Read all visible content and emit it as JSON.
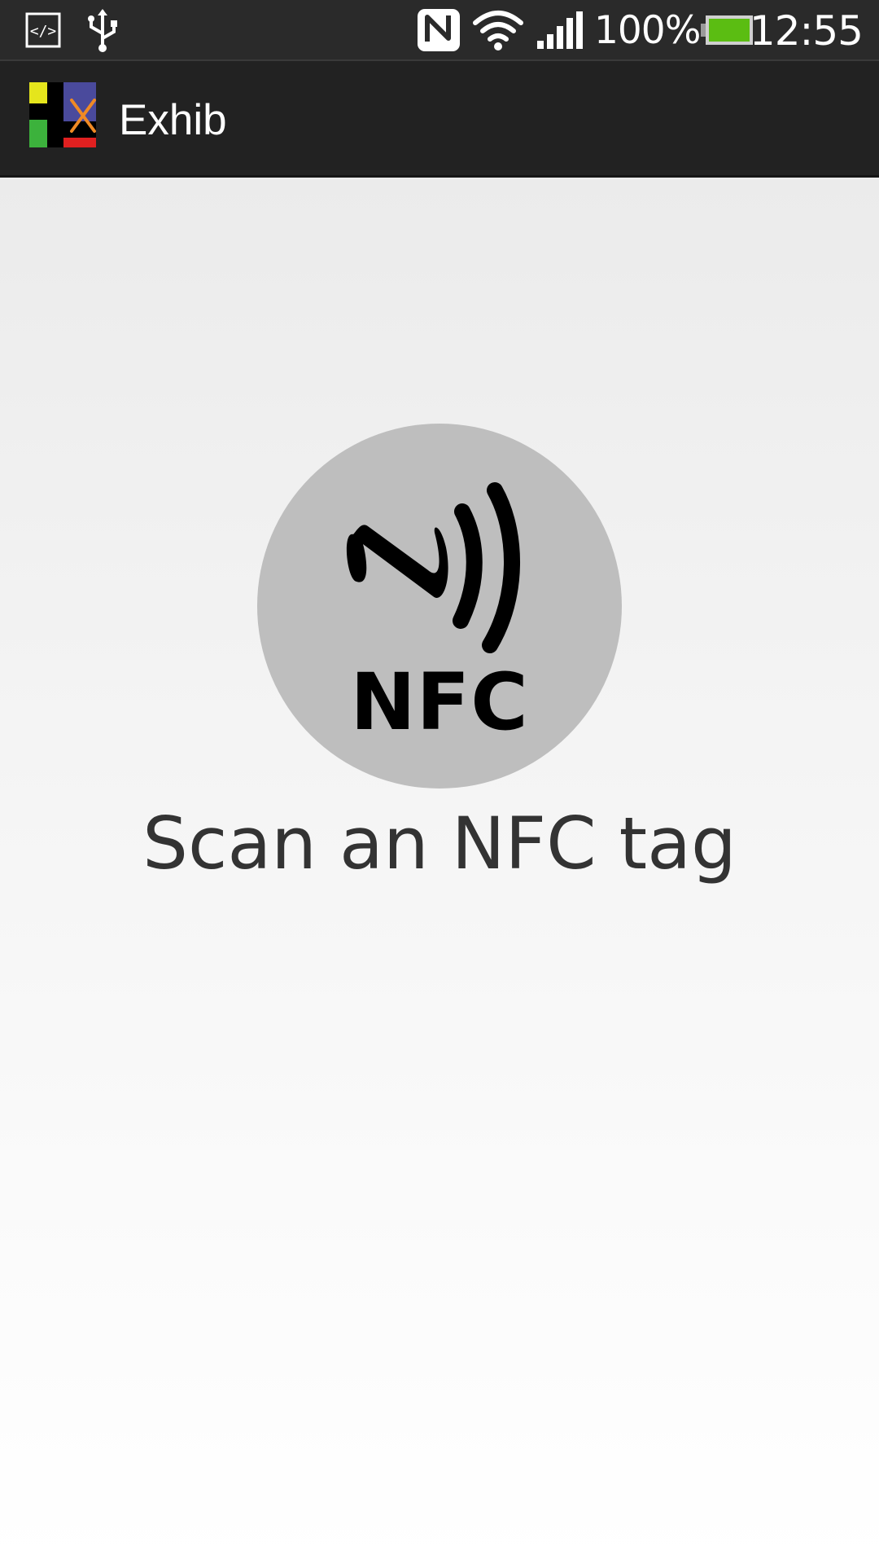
{
  "status_bar": {
    "icons": [
      "debug-icon",
      "usb-icon",
      "nfc-status-icon",
      "wifi-icon",
      "signal-icon",
      "battery-icon"
    ],
    "battery_percent": "100%",
    "clock": "12:55",
    "battery_color": "#5bbd12"
  },
  "action_bar": {
    "title": "Exhib",
    "logo_colors": {
      "yellow": "#e5e51c",
      "green": "#3cb23c",
      "blue": "#4a4a9c",
      "red": "#e02020",
      "orange": "#f08a24"
    }
  },
  "main": {
    "nfc_button_label": "NFC",
    "nfc_button_icon": "nfc-waves-icon",
    "nfc_button_color": "#bebebe",
    "instruction": "Scan an NFC tag"
  }
}
